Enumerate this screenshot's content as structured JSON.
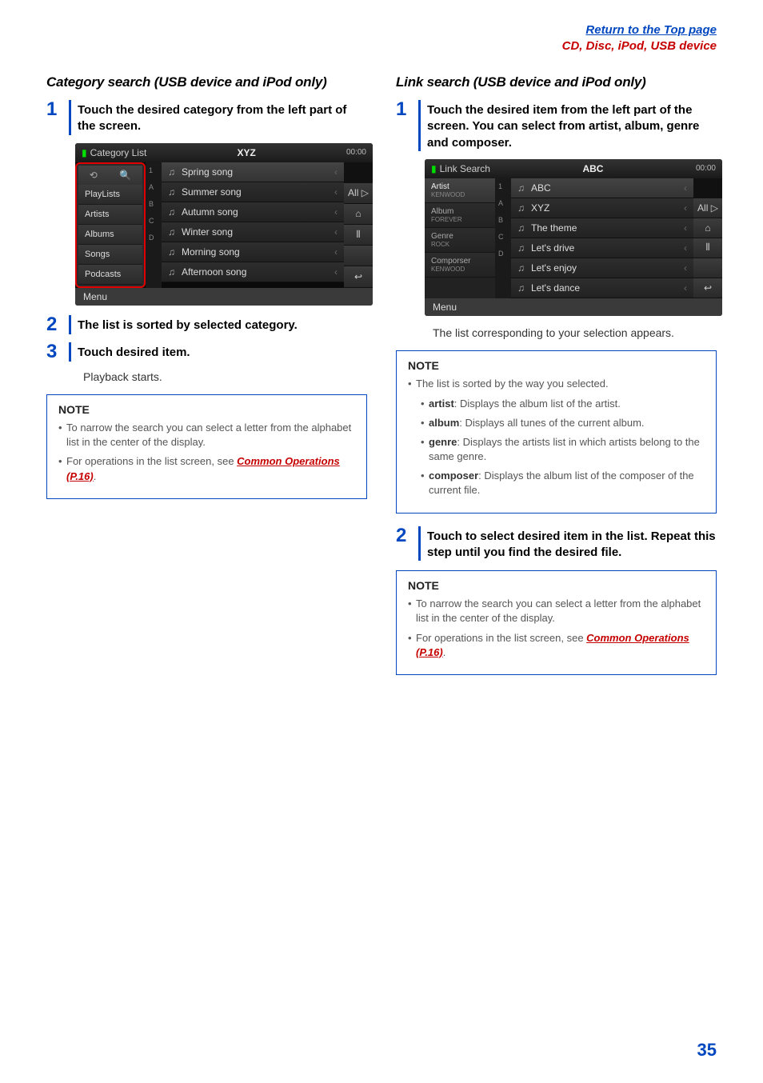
{
  "header": {
    "top_link": "Return to the Top page",
    "bread": "CD, Disc, iPod, USB device"
  },
  "left": {
    "title": "Category search (USB device and iPod only)",
    "step1": "Touch the desired category from the left part of the screen.",
    "shot": {
      "tab": "Category List",
      "center": "XYZ",
      "clock": "00:00",
      "left_top_icons": [
        "⟲",
        "🔍"
      ],
      "cats": [
        "PlayLists",
        "Artists",
        "Albums",
        "Songs",
        "Podcasts"
      ],
      "alpha": [
        "1",
        "A",
        "B",
        "C",
        "D"
      ],
      "rows": [
        "Spring song",
        "Summer song",
        "Autumn song",
        "Winter song",
        "Morning song",
        "Afternoon song"
      ],
      "rbtns": [
        "",
        "All ▷",
        "⌂",
        "⫴",
        "",
        "↩"
      ],
      "menu": "Menu"
    },
    "step2": "The list is sorted by selected category.",
    "step3": "Touch desired item.",
    "step3_sub": "Playback starts.",
    "note": {
      "title": "NOTE",
      "items": [
        {
          "text": "To narrow the search you can select a letter from the alphabet list in the center of the display."
        },
        {
          "text": "For operations in the list screen, see ",
          "link": "Common Operations (P.16)",
          "after": "."
        }
      ]
    }
  },
  "right": {
    "title": "Link search (USB device and iPod only)",
    "step1": "Touch the desired item from the left part of the screen. You can select from artist, album, genre and composer.",
    "shot": {
      "tab": "Link Search",
      "center": "ABC",
      "clock": "00:00",
      "left_rows": [
        {
          "label": "Artist",
          "sub": "KENWOOD",
          "active": true
        },
        {
          "label": "Album",
          "sub": "FOREVER"
        },
        {
          "label": "Genre",
          "sub": "ROCK"
        },
        {
          "label": "Comporser",
          "sub": "KENWOOD"
        }
      ],
      "alpha": [
        "1",
        "A",
        "B",
        "C",
        "D"
      ],
      "rows": [
        "ABC",
        "XYZ",
        "The theme",
        "Let's drive",
        "Let's enjoy",
        "Let's dance"
      ],
      "rbtns": [
        "",
        "All ▷",
        "⌂",
        "⫴",
        "",
        "↩"
      ],
      "menu": "Menu"
    },
    "step1_sub": "The list corresponding to your selection appears.",
    "note1": {
      "title": "NOTE",
      "intro": "The list is sorted by the way you selected.",
      "subs": [
        {
          "label": "artist",
          "text": ": Displays the album list of the artist."
        },
        {
          "label": "album",
          "text": ": Displays all tunes of the current album."
        },
        {
          "label": "genre",
          "text": ": Displays the artists list in which artists belong to the same genre."
        },
        {
          "label": "composer",
          "text": ": Displays the album list of the composer of the current file."
        }
      ]
    },
    "step2": "Touch to select desired item in the list. Repeat this step until you find the desired file.",
    "note2": {
      "title": "NOTE",
      "items": [
        {
          "text": "To narrow the search you can select a letter from the alphabet list in the center of the display."
        },
        {
          "text": "For operations in the list screen, see ",
          "link": "Common Operations (P.16)",
          "after": "."
        }
      ]
    }
  },
  "page_num": "35"
}
